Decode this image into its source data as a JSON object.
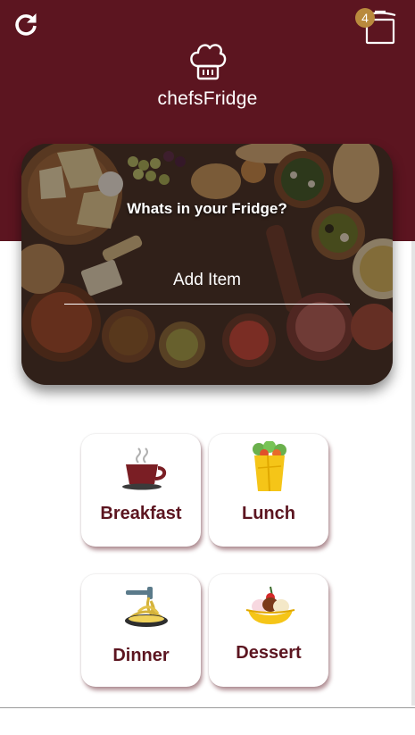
{
  "header": {
    "app_title": "chefsFridge",
    "logo_icon": "chef-hat-icon",
    "refresh_icon": "refresh-icon",
    "pot_icon": "cooking-pot-icon",
    "pot_count": "4",
    "background_color": "#5c1520",
    "badge_color": "#b98a3d"
  },
  "fridge": {
    "title": "Whats in your Fridge?",
    "input_placeholder": "Add Item",
    "input_value": ""
  },
  "categories": [
    {
      "label": "Breakfast",
      "icon": "coffee-cup-icon"
    },
    {
      "label": "Lunch",
      "icon": "wrap-icon"
    },
    {
      "label": "Dinner",
      "icon": "spaghetti-icon"
    },
    {
      "label": "Dessert",
      "icon": "banana-split-icon"
    }
  ],
  "colors": {
    "label_color": "#5c1520",
    "card_background": "#ffffff"
  }
}
